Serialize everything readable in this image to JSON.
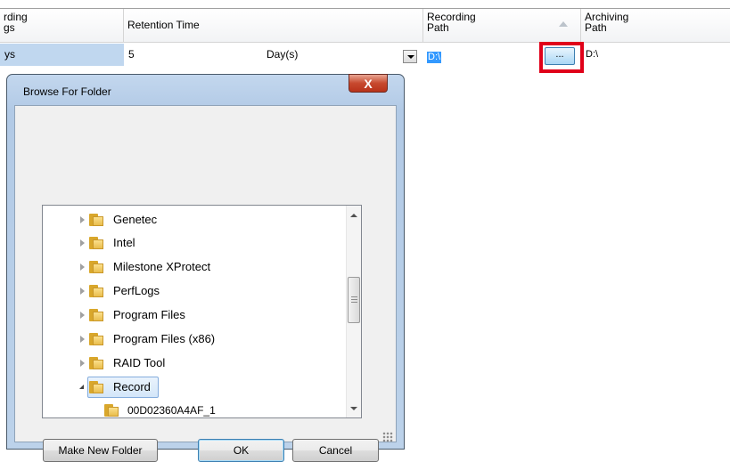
{
  "grid": {
    "columns": [
      {
        "id": "recording_days",
        "lines": [
          "rding",
          "gs"
        ]
      },
      {
        "id": "retention_time",
        "lines": [
          "Retention Time"
        ]
      },
      {
        "id": "recording_path",
        "lines": [
          "Recording",
          "Path"
        ]
      },
      {
        "id": "archiving_path",
        "lines": [
          "Archiving",
          "Path"
        ]
      }
    ],
    "row": {
      "first_cell": "ys",
      "retention_value": "5",
      "retention_unit": "Day(s)",
      "recording_path": "D:\\",
      "browse_button_label": "...",
      "archiving_path": "D:\\"
    },
    "highlight_color": "#e00019"
  },
  "dialog": {
    "title": "Browse For Folder",
    "close_label": "X",
    "tree": [
      {
        "label": "Genetec",
        "expanded": false
      },
      {
        "label": "Intel",
        "expanded": false
      },
      {
        "label": "Milestone XProtect",
        "expanded": false
      },
      {
        "label": "PerfLogs",
        "expanded": false
      },
      {
        "label": "Program Files",
        "expanded": false
      },
      {
        "label": "Program Files (x86)",
        "expanded": false
      },
      {
        "label": "RAID Tool",
        "expanded": false
      },
      {
        "label": "Record",
        "expanded": true,
        "selected": true
      },
      {
        "label": "00D02360A4AF_1",
        "child": true
      }
    ],
    "buttons": {
      "new_folder": "Make New Folder",
      "ok": "OK",
      "cancel": "Cancel"
    }
  }
}
